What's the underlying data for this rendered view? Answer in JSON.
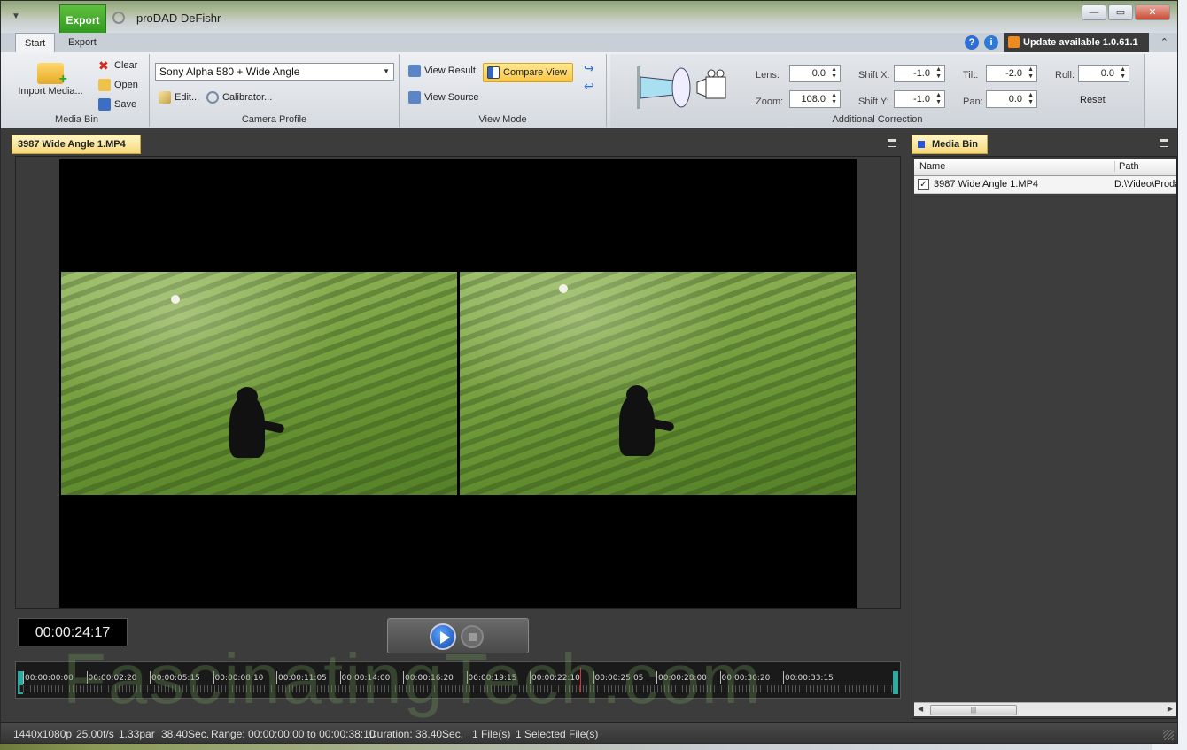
{
  "app": {
    "title": "proDAD DeFishr",
    "quick_export_label": "Export"
  },
  "ribbon_tabs": [
    {
      "label": "Start",
      "active": true
    },
    {
      "label": "Export",
      "active": false
    }
  ],
  "update_badge": "Update available 1.0.61.1",
  "media_bin_group": {
    "import_label": "Import Media...",
    "clear_label": "Clear",
    "open_label": "Open",
    "save_label": "Save",
    "group_label": "Media Bin"
  },
  "camera_profile_group": {
    "selected_profile": "Sony Alpha 580 + Wide Angle",
    "edit_label": "Edit...",
    "calibrator_label": "Calibrator...",
    "group_label": "Camera Profile"
  },
  "view_mode_group": {
    "view_result_label": "View Result",
    "compare_view_label": "Compare View",
    "view_source_label": "View Source",
    "group_label": "View Mode"
  },
  "additional_correction": {
    "group_label": "Additional Correction",
    "lens": {
      "label": "Lens:",
      "value": "0.0"
    },
    "zoom": {
      "label": "Zoom:",
      "value": "108.0"
    },
    "shift_x": {
      "label": "Shift X:",
      "value": "-1.0"
    },
    "shift_y": {
      "label": "Shift Y:",
      "value": "-1.0"
    },
    "tilt": {
      "label": "Tilt:",
      "value": "-2.0"
    },
    "pan": {
      "label": "Pan:",
      "value": "0.0"
    },
    "roll": {
      "label": "Roll:",
      "value": "0.0"
    },
    "reset_label": "Reset"
  },
  "viewer": {
    "tab_title": "3987 Wide Angle 1.MP4",
    "timecode": "00:00:24:17"
  },
  "timeline": {
    "ticks": [
      "00:00:00:00",
      "00:00:02:20",
      "00:00:05:15",
      "00:00:08:10",
      "00:00:11:05",
      "00:00:14:00",
      "00:00:16:20",
      "00:00:19:15",
      "00:00:22:10",
      "00:00:25:05",
      "00:00:28:00",
      "00:00:30:20",
      "00:00:33:15"
    ],
    "playhead_fraction": 0.641
  },
  "watermark": "FascinatingTech.com",
  "media_bin_panel": {
    "tab_title": "Media Bin",
    "columns": {
      "name": "Name",
      "path": "Path"
    },
    "rows": [
      {
        "checked": true,
        "name": "3987 Wide Angle 1.MP4",
        "path": "D:\\Video\\Proda"
      }
    ]
  },
  "status_bar": {
    "resolution": "1440x1080p",
    "fps": "25.00f/s",
    "par": "1.33par",
    "length": "38.40Sec.",
    "range": "Range: 00:00:00:00 to 00:00:38:10",
    "duration": "Duration: 38.40Sec.",
    "files": "1 File(s)",
    "selected": "1 Selected File(s)"
  },
  "colors": {
    "accent_yellow": "#f8c646",
    "export_green": "#2f9a1d",
    "range_marker": "#2fa8a0",
    "playhead": "#e03030"
  }
}
